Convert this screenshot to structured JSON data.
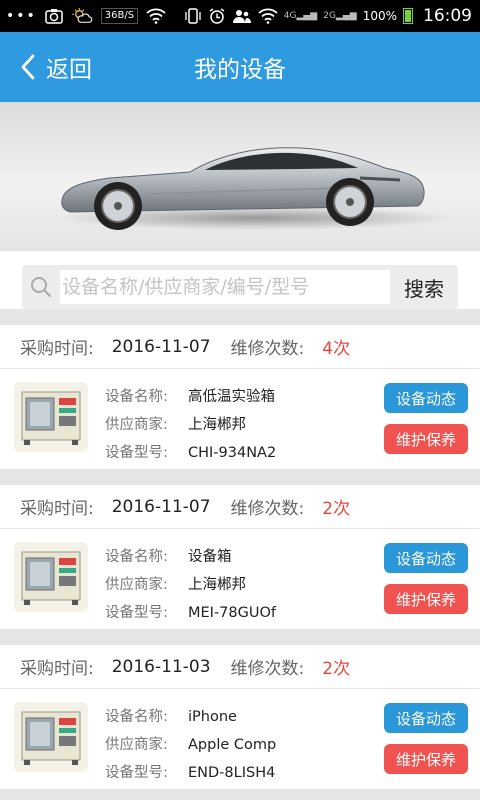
{
  "status_bar": {
    "dots": "•••",
    "speed": "36B/S",
    "signal_4g": "4G",
    "signal_2g": "2G",
    "battery": "100%",
    "time": "16:09"
  },
  "header": {
    "back_label": "返回",
    "title": "我的设备"
  },
  "search": {
    "placeholder": "设备名称/供应商家/编号/型号",
    "value": "",
    "button_label": "搜索"
  },
  "labels": {
    "purchase_time": "采购时间:",
    "repair_count": "维修次数:",
    "device_name": "设备名称:",
    "supplier": "供应商家:",
    "model": "设备型号:",
    "dynamics_button": "设备动态",
    "maintenance_button": "维护保养"
  },
  "records": [
    {
      "date": "2016-11-07",
      "repairs": "4次",
      "name": "高低温实验箱",
      "supplier": "上海郴邦",
      "model": "CHI-934NA2"
    },
    {
      "date": "2016-11-07",
      "repairs": "2次",
      "name": "设备箱",
      "supplier": "上海郴邦",
      "model": "MEI-78GUOf"
    },
    {
      "date": "2016-11-03",
      "repairs": "2次",
      "name": "iPhone",
      "supplier": "Apple Comp",
      "model": "END-8LISH4"
    }
  ],
  "colors": {
    "header_bg": "#2e9ae0",
    "dynamics_button": "#2a97d8",
    "maintenance_button": "#ef5350",
    "repair_count_text": "#e8463b"
  }
}
